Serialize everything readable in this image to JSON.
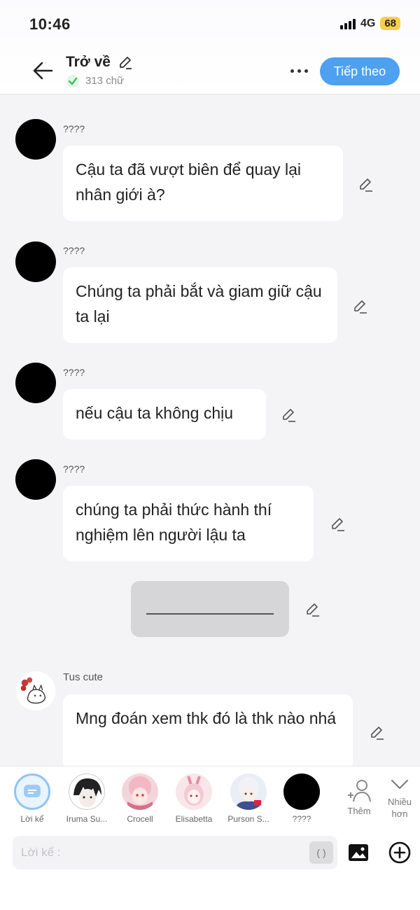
{
  "status_bar": {
    "time": "10:46",
    "network": "4G",
    "battery": "68"
  },
  "header": {
    "back_label": "Trở về",
    "word_count": "313 chữ",
    "next_button": "Tiếp theo"
  },
  "messages": [
    {
      "sender": "????",
      "text": "Cậu ta đã vượt biên để quay lại nhân giới à?"
    },
    {
      "sender": "????",
      "text": "Chúng ta phải bắt và giam giữ cậu ta lại"
    },
    {
      "sender": "????",
      "text": "nếu cậu ta không chịu"
    },
    {
      "sender": "????",
      "text": "chúng ta phải thức hành thí nghiệm lên người lậu ta"
    },
    {
      "sender": "Tus cute",
      "text": "Mng đoán xem thk đó là thk nào nhá"
    }
  ],
  "characters": [
    {
      "name": "Lời kể",
      "icon": "narration-icon"
    },
    {
      "name": "Iruma Su...",
      "icon": "iruma-avatar"
    },
    {
      "name": "Crocell",
      "icon": "crocell-avatar"
    },
    {
      "name": "Elisabetta",
      "icon": "elisabetta-avatar"
    },
    {
      "name": "Purson S...",
      "icon": "purson-avatar"
    },
    {
      "name": "????",
      "icon": "unknown-avatar"
    }
  ],
  "actions": {
    "add_label": "Thêm",
    "more_label": "Nhiều hơn"
  },
  "input": {
    "placeholder": "Lời kể :",
    "paren": "( )"
  },
  "colors": {
    "accent": "#4ea0f0",
    "battery": "#f6cf4a",
    "check": "#3fbf5a"
  }
}
